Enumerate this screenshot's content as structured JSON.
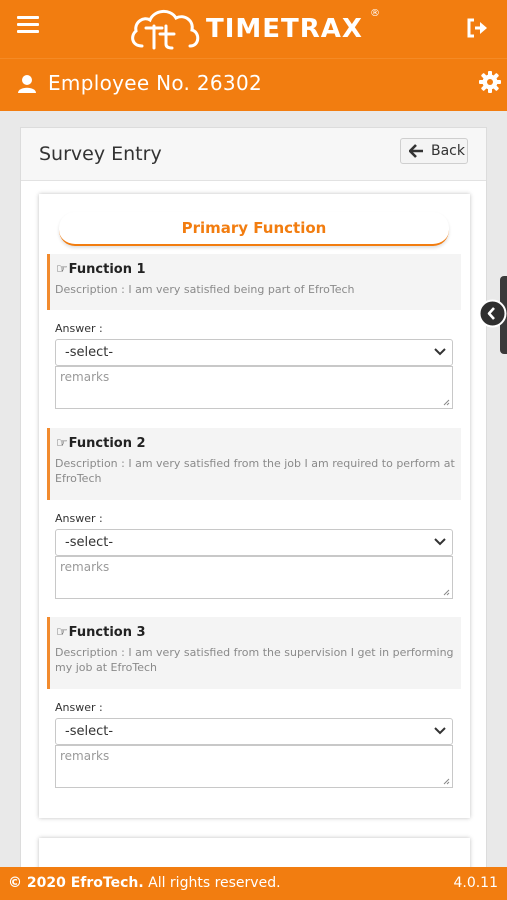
{
  "header": {
    "app_name": "TIMETRAX",
    "registered_mark": "®",
    "employee_label": "Employee No. 26302"
  },
  "icons": {
    "menu": "hamburger-icon",
    "logout": "logout-icon",
    "user": "user-icon",
    "settings": "gear-icon",
    "back": "arrow-left-icon",
    "pointer": "hand-pointer-icon",
    "select": "chevron-down-icon",
    "sidebar": "chevron-left-icon"
  },
  "colors": {
    "brand_orange": "#f27d10",
    "question_accent": "#f28b2e"
  },
  "page": {
    "title": "Survey Entry",
    "back_label": "Back"
  },
  "section": {
    "title": "Primary Function"
  },
  "questions": [
    {
      "title": "Function 1",
      "description": "Description : I am very satisfied being part of EfroTech",
      "answer_label": "Answer :",
      "select_value": "-select-",
      "remarks_placeholder": "remarks"
    },
    {
      "title": "Function 2",
      "description": "Description : I am very satisfied from the job I am required to perform at EfroTech",
      "answer_label": "Answer :",
      "select_value": "-select-",
      "remarks_placeholder": "remarks"
    },
    {
      "title": "Function 3",
      "description": "Description : I am very satisfied from the supervision I get in performing my job at EfroTech",
      "answer_label": "Answer :",
      "select_value": "-select-",
      "remarks_placeholder": "remarks"
    }
  ],
  "footer": {
    "copyright_prefix": "© 2020 EfroTech.",
    "copyright_suffix": " All rights reserved.",
    "version": "4.0.11"
  }
}
